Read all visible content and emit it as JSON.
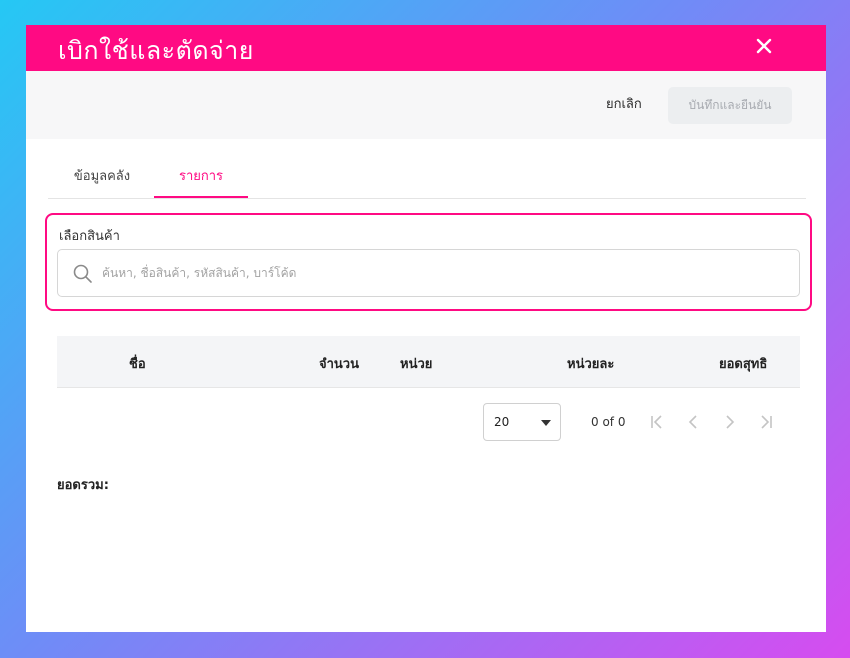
{
  "dialog": {
    "title": "เบิกใช้และตัดจ่าย",
    "close_icon": "close-icon"
  },
  "actions": {
    "cancel_label": "ยกเลิก",
    "save_label": "บันทึกและยืนยัน"
  },
  "tabs": [
    {
      "label": "ข้อมูลคลัง",
      "active": false
    },
    {
      "label": "รายการ",
      "active": true
    }
  ],
  "product": {
    "label": "เลือกสินค้า",
    "search_placeholder": "ค้นหา, ชื่อสินค้า, รหัสสินค้า, บาร์โค้ด",
    "search_value": ""
  },
  "table": {
    "columns": [
      "ชื่อ",
      "จำนวน",
      "หน่วย",
      "หน่วยละ",
      "ยอดสุทธิ"
    ],
    "rows": []
  },
  "pagination": {
    "rows_per_page": "20",
    "range_text": "0 of 0"
  },
  "summary": {
    "total_label": "ยอดรวม:"
  },
  "colors": {
    "accent": "#ff0a83",
    "disabled_button": "#eceef0"
  }
}
